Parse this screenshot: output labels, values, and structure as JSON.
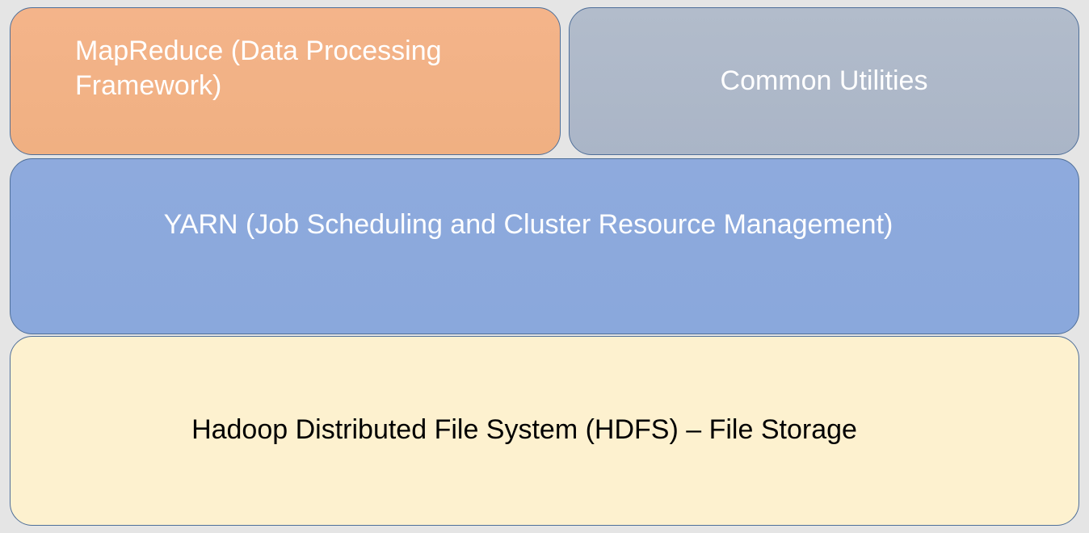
{
  "diagram": {
    "layers": {
      "mapreduce": {
        "label": "MapReduce (Data Processing Framework)"
      },
      "common": {
        "label": "Common Utilities"
      },
      "yarn": {
        "label": "YARN (Job Scheduling and Cluster Resource Management)"
      },
      "hdfs": {
        "label": "Hadoop Distributed File System (HDFS) – File Storage"
      }
    },
    "colors": {
      "mapreduce_fill": "#f2b185",
      "common_fill": "#adb8c9",
      "yarn_fill": "#8ca9dc",
      "hdfs_fill": "#fdf1cf",
      "border": "#4f6f99",
      "background": "#e5e5e5"
    }
  }
}
